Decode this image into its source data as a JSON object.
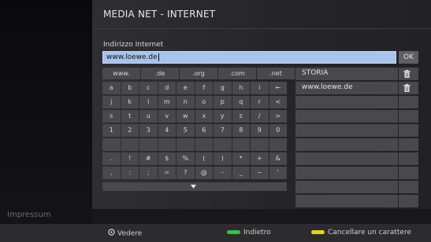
{
  "window": {
    "title": "MEDIA NET - INTERNET"
  },
  "address": {
    "label": "Indirizzo Internet",
    "value": "www.loewe.de",
    "ok_label": "OK"
  },
  "keyboard": {
    "domain_keys": [
      "www.",
      ".de",
      ".org",
      ".com",
      ".net"
    ],
    "rows": [
      [
        "a",
        "b",
        "c",
        "d",
        "e",
        "f",
        "g",
        "h",
        "i",
        "←"
      ],
      [
        "j",
        "k",
        "l",
        "m",
        "n",
        "o",
        "p",
        "q",
        "r",
        "<"
      ],
      [
        "s",
        "t",
        "u",
        "v",
        "w",
        "x",
        "y",
        "z",
        "/",
        ">"
      ],
      [
        "1",
        "2",
        "3",
        "4",
        "5",
        "6",
        "7",
        "8",
        "9",
        "0"
      ],
      [
        "",
        "",
        "",
        "",
        "",
        "",
        "",
        "",
        "",
        ""
      ],
      [
        ".",
        "!",
        "#",
        "$",
        "%",
        "(",
        ")",
        "*",
        "+",
        "&"
      ],
      [
        ",",
        ":",
        ";",
        "=",
        "?",
        "@",
        "-",
        "_",
        "~",
        "'"
      ]
    ],
    "scroll_down_icon": "triangle-down"
  },
  "history": {
    "header": "STORIA",
    "items": [
      "www.loewe.de",
      "",
      "",
      "",
      "",
      "",
      "",
      "",
      "",
      ""
    ],
    "delete_icon": "trash-icon"
  },
  "sidebar": {
    "imprint": "Impressum"
  },
  "footer": {
    "view_label": "Vedere",
    "back_label": "Indietro",
    "delete_char_label": "Cancellare un carattere",
    "colors": {
      "green": "#35c04a",
      "yellow": "#e6d21c"
    }
  }
}
